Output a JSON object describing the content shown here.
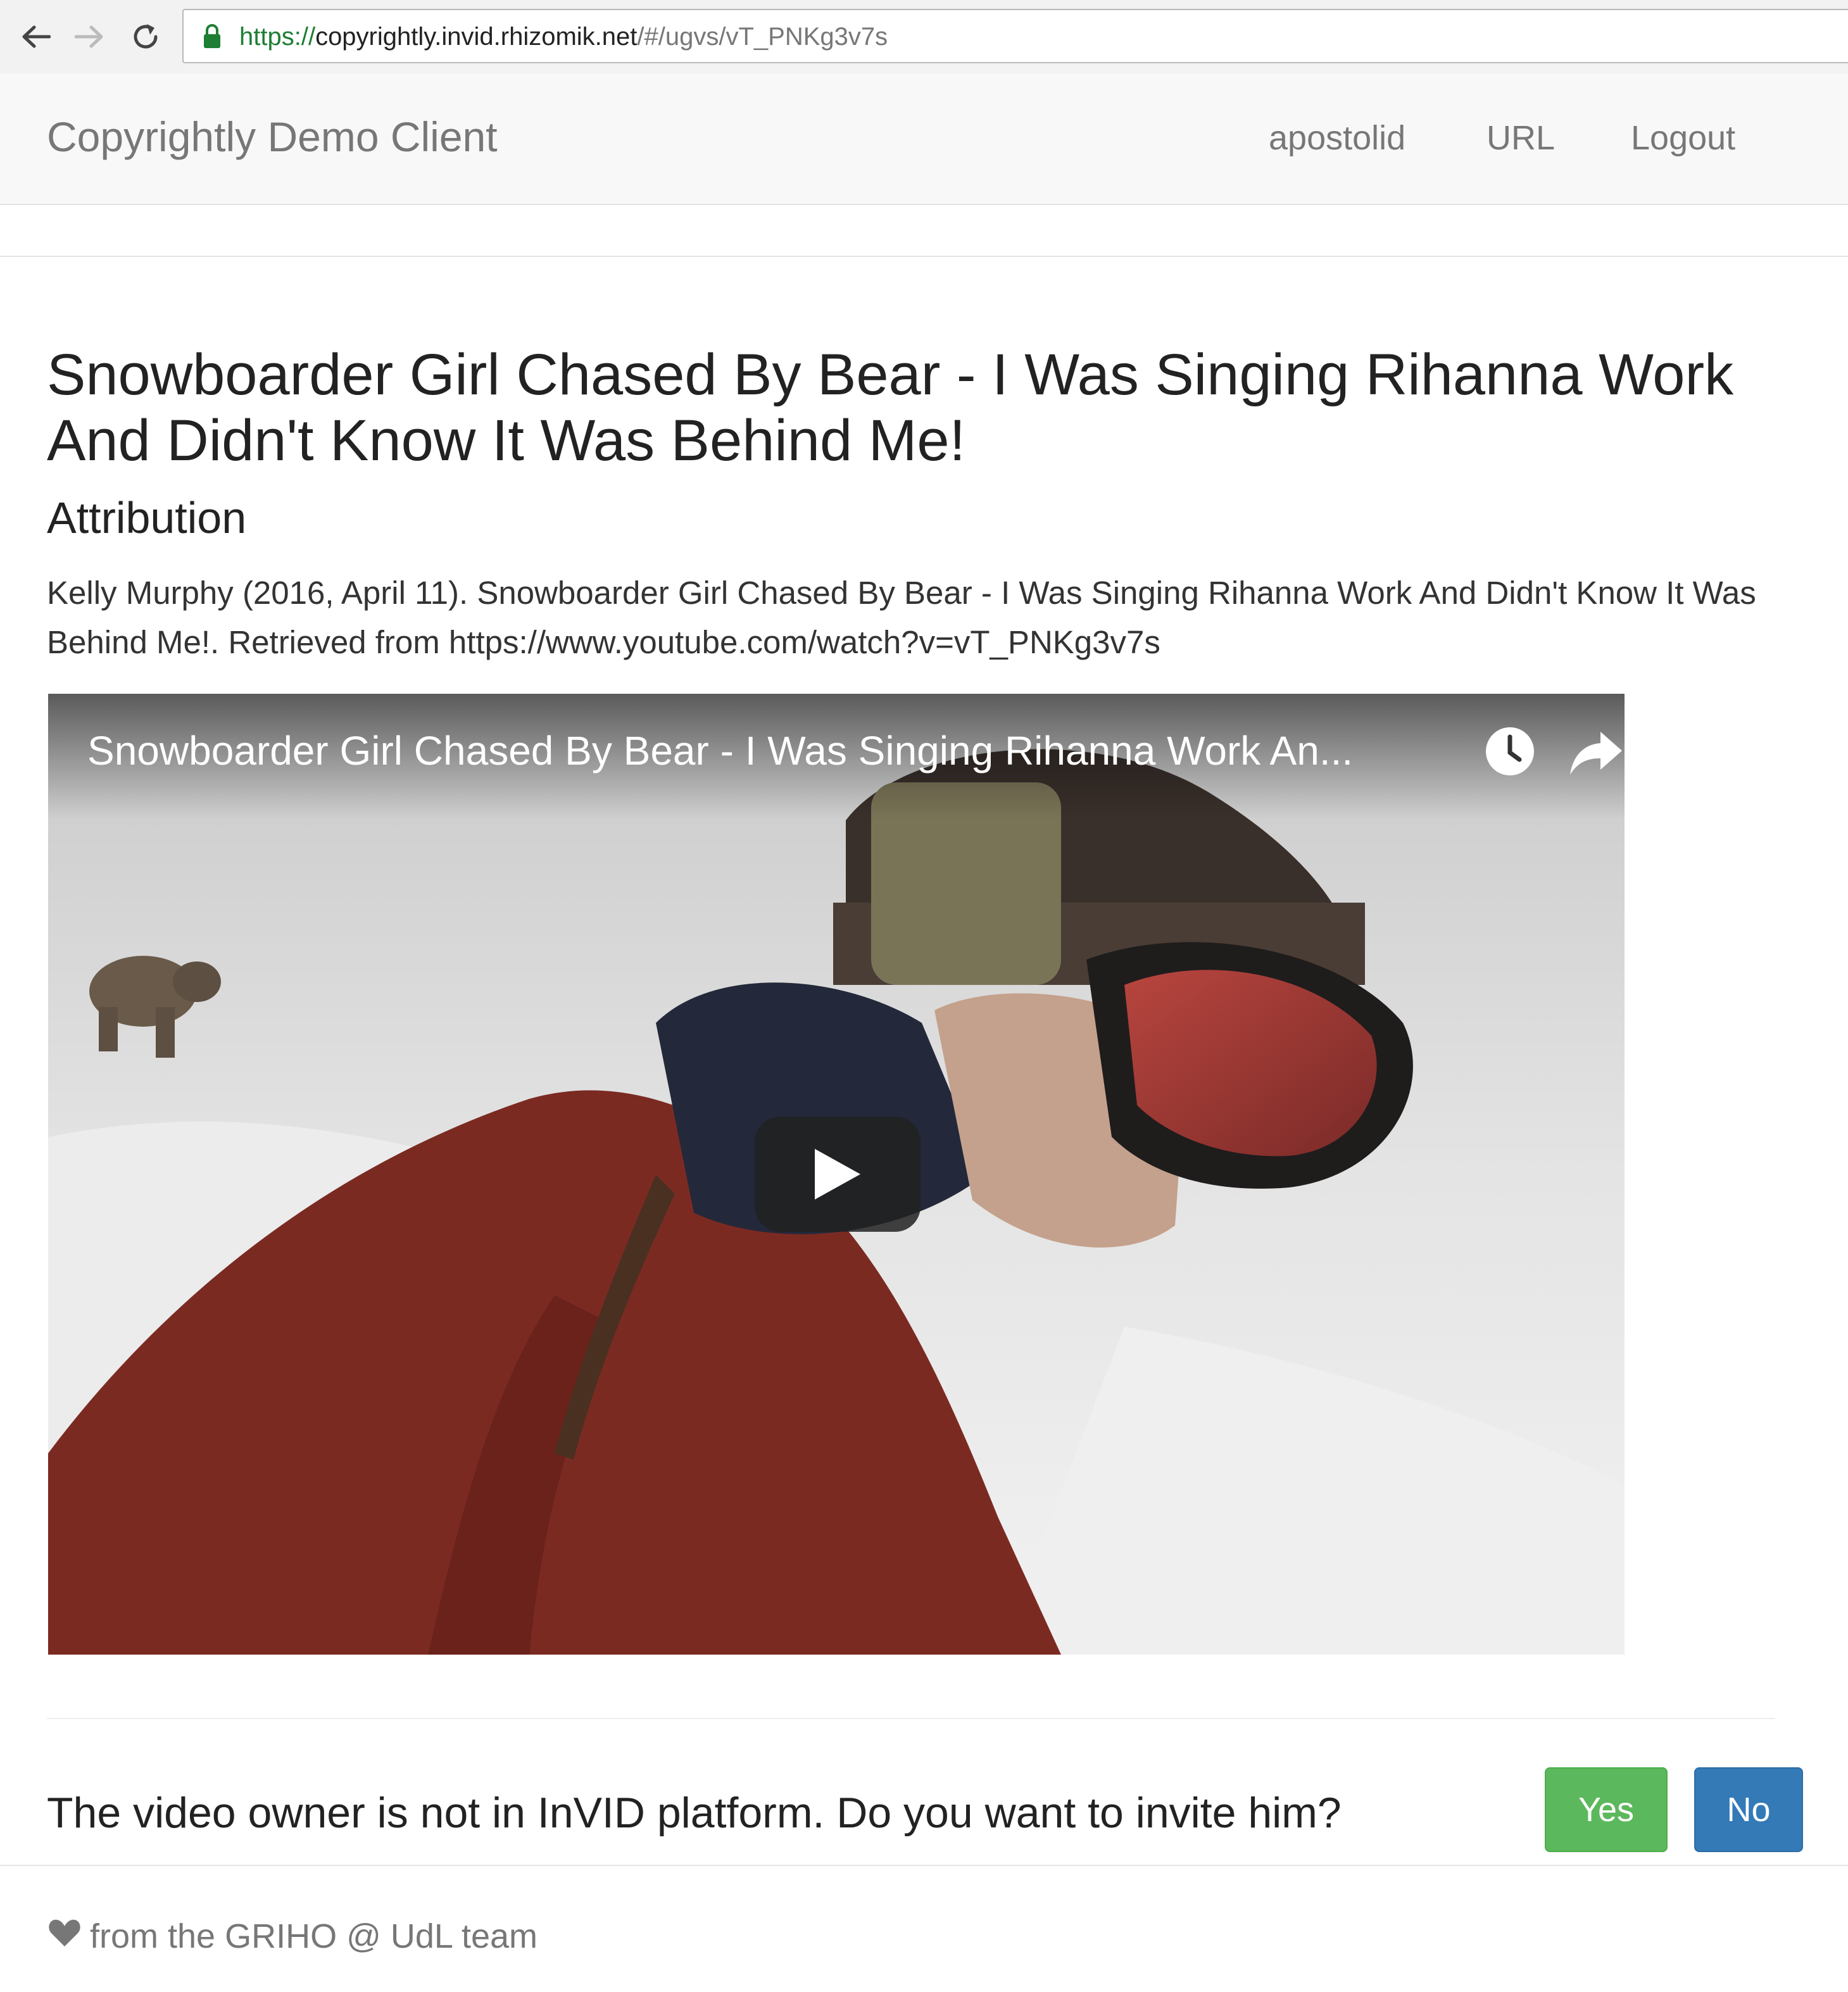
{
  "browser": {
    "url_scheme": "https://",
    "url_host": "copyrightly.invid.rhizomik.net",
    "url_path": "/#/ugvs/vT_PNKg3v7s"
  },
  "navbar": {
    "brand": "Copyrightly Demo Client",
    "links": [
      "apostolid",
      "URL",
      "Logout"
    ]
  },
  "content": {
    "title": "Snowboarder Girl Chased By Bear - I Was Singing Rihanna Work And Didn't Know It Was Behind Me!",
    "attribution_heading": "Attribution",
    "attribution_text": "Kelly Murphy (2016, April 11). Snowboarder Girl Chased By Bear - I Was Singing Rihanna Work And Didn't Know It Was Behind Me!. Retrieved from https://www.youtube.com/watch?v=vT_PNKg3v7s"
  },
  "video": {
    "title": "Snowboarder Girl Chased By Bear - I Was Singing Rihanna Work An..."
  },
  "invite": {
    "question": "The video owner is not in InVID platform. Do you want to invite him?",
    "yes_label": "Yes",
    "no_label": "No",
    "yes_color": "#5cb85c",
    "no_color": "#337ab7"
  },
  "footer": {
    "text": "from the GRIHO @ UdL team",
    "icon": "heart-icon"
  }
}
